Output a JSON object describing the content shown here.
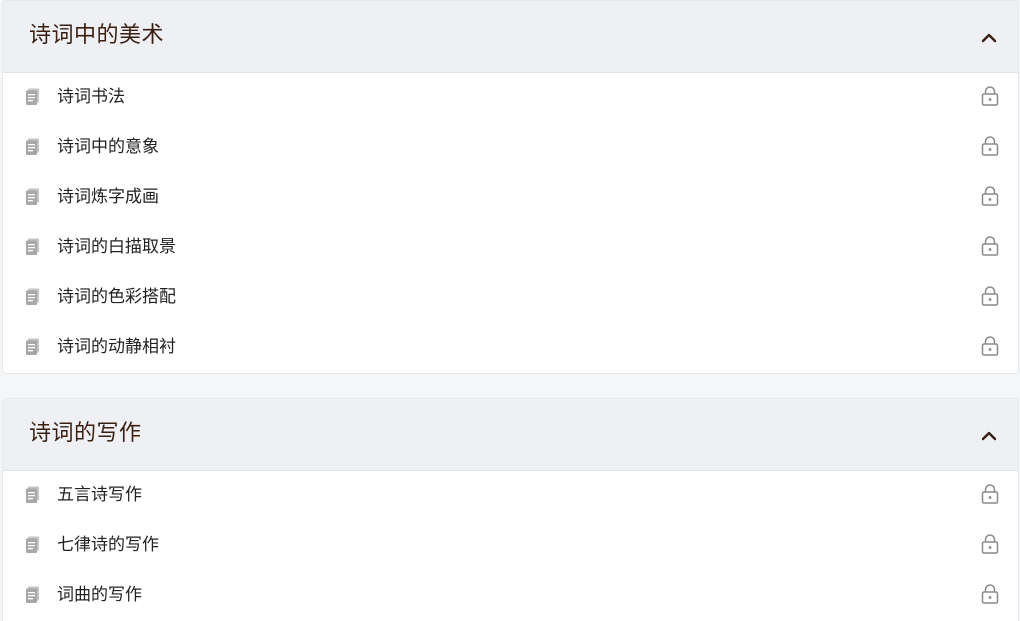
{
  "sections": [
    {
      "title": "诗词中的美术",
      "expanded": true,
      "items": [
        {
          "label": "诗词书法",
          "icon": "document-icon",
          "status_icon": "lock-icon"
        },
        {
          "label": "诗词中的意象",
          "icon": "document-icon",
          "status_icon": "lock-icon"
        },
        {
          "label": "诗词炼字成画",
          "icon": "document-icon",
          "status_icon": "lock-icon"
        },
        {
          "label": "诗词的白描取景",
          "icon": "document-icon",
          "status_icon": "lock-icon"
        },
        {
          "label": "诗词的色彩搭配",
          "icon": "document-icon",
          "status_icon": "lock-icon"
        },
        {
          "label": "诗词的动静相衬",
          "icon": "document-icon",
          "status_icon": "lock-icon"
        }
      ]
    },
    {
      "title": "诗词的写作",
      "expanded": true,
      "items": [
        {
          "label": "五言诗写作",
          "icon": "document-icon",
          "status_icon": "lock-icon"
        },
        {
          "label": "七律诗的写作",
          "icon": "document-icon",
          "status_icon": "lock-icon"
        },
        {
          "label": "词曲的写作",
          "icon": "document-icon",
          "status_icon": "lock-icon"
        }
      ]
    }
  ],
  "colors": {
    "header_bg": "#eff0f4",
    "title_text": "#3a1f10",
    "item_text": "#222222",
    "icon_gray": "#a8a8a8"
  }
}
